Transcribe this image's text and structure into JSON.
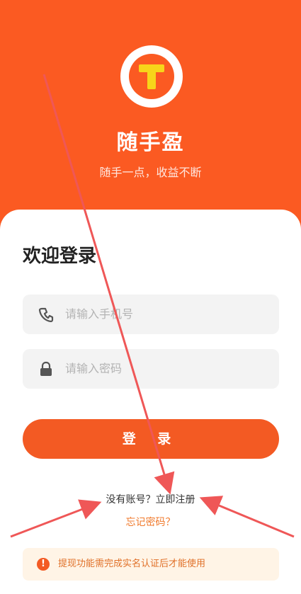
{
  "app": {
    "name": "随手盈",
    "tagline": "随手一点，收益不断"
  },
  "login": {
    "welcome": "欢迎登录",
    "phone_placeholder": "请输入手机号",
    "password_placeholder": "请输入密码",
    "login_button": "登 录",
    "register_link": "没有账号？立即注册",
    "forgot_link": "忘记密码？",
    "notice": "提现功能需完成实名认证后才能使用",
    "notice_icon": "!"
  },
  "colors": {
    "brand": "#fb5a22",
    "logo_yellow": "#f7d51a",
    "annotation_red": "#ef5757"
  },
  "icons": {
    "logo": "t-logo-icon",
    "phone": "phone-icon",
    "password": "lock-icon",
    "notice": "info-icon"
  }
}
